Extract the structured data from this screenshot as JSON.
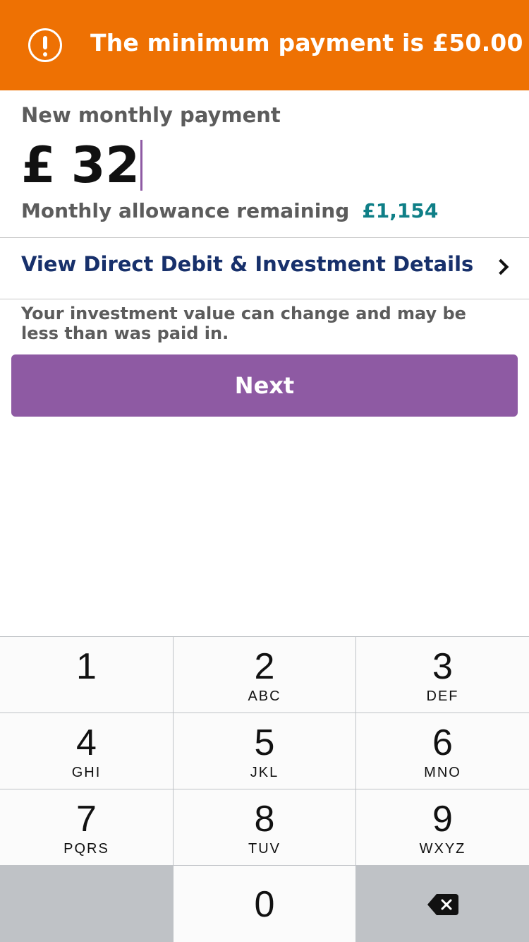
{
  "alert": {
    "message": "The minimum payment is £50.00",
    "icon": "exclamation-circle-icon"
  },
  "payment": {
    "label": "New monthly payment",
    "currency": "£",
    "amount": "32",
    "allowance_label": "Monthly allowance remaining",
    "allowance_value": "£1,154"
  },
  "details_link": {
    "label": "View Direct Debit & Investment Details",
    "icon": "chevron-right-icon"
  },
  "disclaimer": "Your investment value can change and may be less than was paid in.",
  "next_button": {
    "label": "Next"
  },
  "keypad": {
    "keys": [
      {
        "digit": "1",
        "letters": ""
      },
      {
        "digit": "2",
        "letters": "ABC"
      },
      {
        "digit": "3",
        "letters": "DEF"
      },
      {
        "digit": "4",
        "letters": "GHI"
      },
      {
        "digit": "5",
        "letters": "JKL"
      },
      {
        "digit": "6",
        "letters": "MNO"
      },
      {
        "digit": "7",
        "letters": "PQRS"
      },
      {
        "digit": "8",
        "letters": "TUV"
      },
      {
        "digit": "9",
        "letters": "WXYZ"
      },
      {
        "digit": "0",
        "letters": ""
      }
    ],
    "delete_icon": "backspace-icon"
  },
  "colors": {
    "alert_background": "#ee7103",
    "accent_purple": "#8e5aa3",
    "link_navy": "#17306b",
    "allowance_teal": "#0f7f87"
  }
}
